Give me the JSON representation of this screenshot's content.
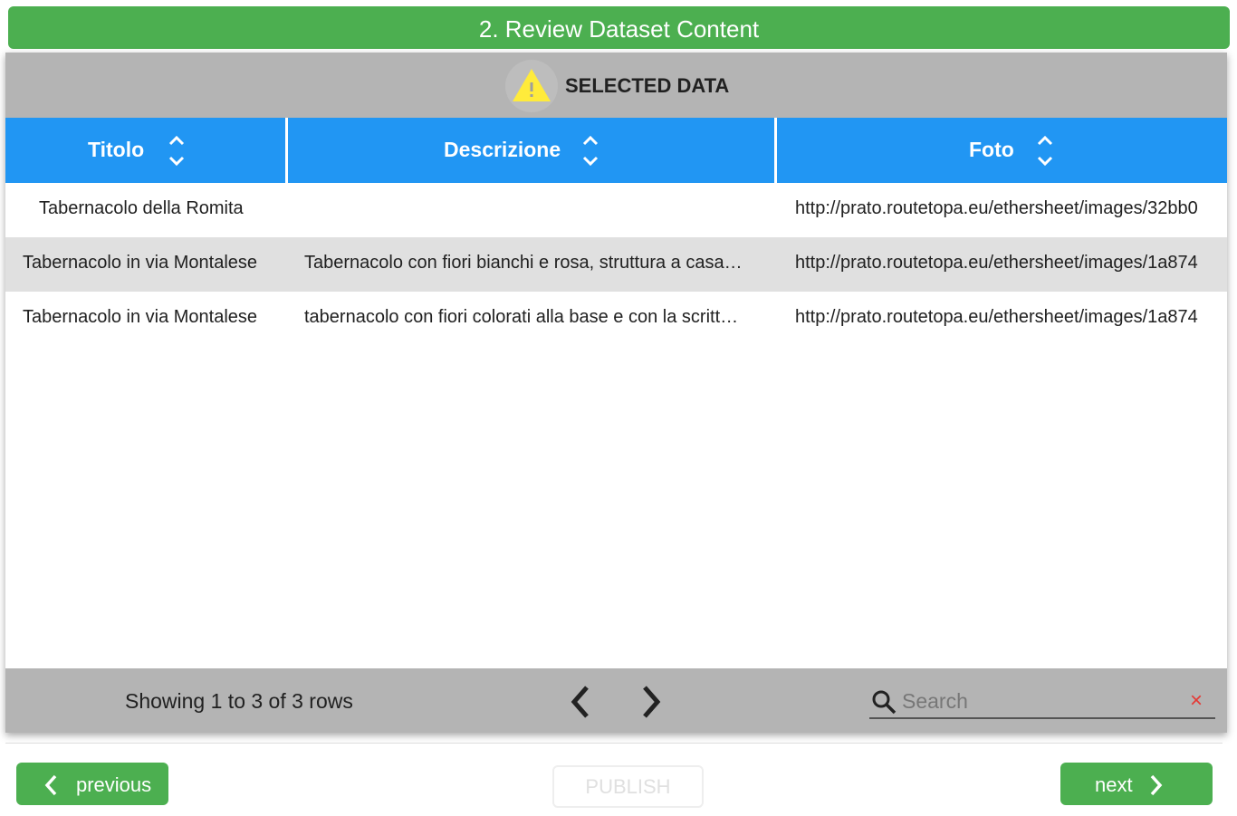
{
  "step_title": "2. Review Dataset Content",
  "panel": {
    "title": "SELECTED DATA"
  },
  "columns": [
    {
      "label": "Titolo"
    },
    {
      "label": "Descrizione"
    },
    {
      "label": "Foto"
    }
  ],
  "rows": [
    {
      "titolo": "Tabernacolo della Romita",
      "descrizione": "",
      "foto": "http://prato.routetopa.eu/ethersheet/images/32bb0"
    },
    {
      "titolo": "Tabernacolo in via Montalese",
      "descrizione": "Tabernacolo con fiori bianchi e rosa, struttura a casa…",
      "foto": "http://prato.routetopa.eu/ethersheet/images/1a874"
    },
    {
      "titolo": "Tabernacolo in via Montalese",
      "descrizione": "tabernacolo con fiori colorati alla base e con la scritt…",
      "foto": "http://prato.routetopa.eu/ethersheet/images/1a874"
    }
  ],
  "footer": {
    "showing_text": "Showing 1 to 3 of 3 rows",
    "search_placeholder": "Search",
    "search_value": "",
    "clear_symbol": "×"
  },
  "buttons": {
    "previous": "previous",
    "publish": "PUBLISH",
    "next": "next"
  },
  "colors": {
    "green": "#4caf50",
    "header_blue": "#2196f3",
    "toolbar_gray": "#b4b4b4",
    "alt_row": "#e0e0e0",
    "warning_yellow": "#ffeb3b",
    "clear_red": "#e53935"
  },
  "icons": [
    "warning-icon",
    "sort-icon",
    "chevron-left-icon",
    "chevron-right-icon",
    "search-icon",
    "clear-icon"
  ]
}
